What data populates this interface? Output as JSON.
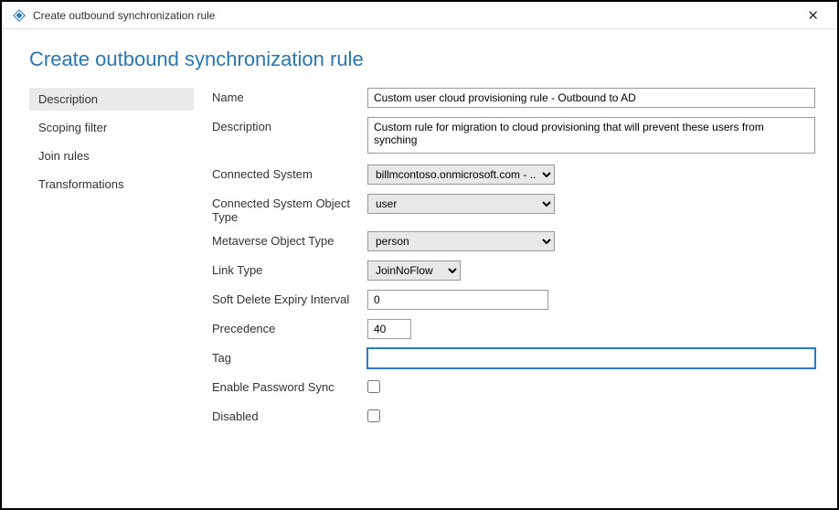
{
  "titleBar": {
    "title": "Create outbound synchronization rule"
  },
  "pageTitle": "Create outbound synchronization rule",
  "sidebar": {
    "items": [
      {
        "label": "Description",
        "active": true
      },
      {
        "label": "Scoping filter",
        "active": false
      },
      {
        "label": "Join rules",
        "active": false
      },
      {
        "label": "Transformations",
        "active": false
      }
    ]
  },
  "form": {
    "name": {
      "label": "Name",
      "value": "Custom user cloud provisioning rule - Outbound to AD"
    },
    "description": {
      "label": "Description",
      "value": "Custom rule for migration to cloud provisioning that will prevent these users from synching"
    },
    "connectedSystem": {
      "label": "Connected System",
      "value": "billmcontoso.onmicrosoft.com - ..."
    },
    "connectedSystemObjectType": {
      "label": "Connected System Object Type",
      "value": "user"
    },
    "metaverseObjectType": {
      "label": "Metaverse Object Type",
      "value": "person"
    },
    "linkType": {
      "label": "Link Type",
      "value": "JoinNoFlow"
    },
    "softDeleteExpiry": {
      "label": "Soft Delete Expiry Interval",
      "value": "0"
    },
    "precedence": {
      "label": "Precedence",
      "value": "40"
    },
    "tag": {
      "label": "Tag",
      "value": ""
    },
    "enablePasswordSync": {
      "label": "Enable Password Sync",
      "checked": false
    },
    "disabled": {
      "label": "Disabled",
      "checked": false
    }
  }
}
